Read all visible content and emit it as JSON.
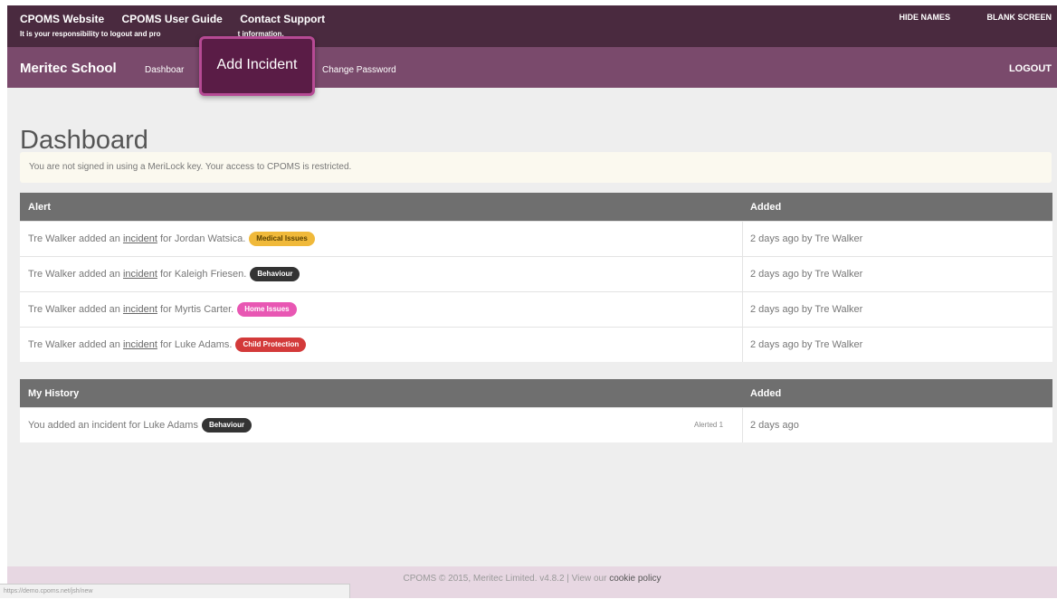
{
  "topbar": {
    "links": [
      "CPOMS Website",
      "CPOMS User Guide",
      "Contact Support"
    ],
    "disclaimer": "It is your responsibility to logout and pro",
    "disclaimer_end": "t information.",
    "hide_names": "HIDE NAMES",
    "blank_screen": "BLANK SCREEN"
  },
  "navbar": {
    "brand": "Meritec School",
    "dashboard": "Dashboar",
    "add_incident": "Add Incident",
    "change_password": "Change Password",
    "logout": "LOGOUT"
  },
  "page": {
    "title": "Dashboard",
    "notice": "You are not signed in using a MeriLock key. Your access to CPOMS is restricted."
  },
  "alerts": {
    "col_alert": "Alert",
    "col_added": "Added",
    "rows": [
      {
        "prefix": "Tre Walker added an ",
        "link": "incident",
        "suffix": " for Jordan Watsica.",
        "badge": "Medical Issues",
        "added": "2 days ago by Tre Walker"
      },
      {
        "prefix": "Tre Walker added an ",
        "link": "incident",
        "suffix": " for Kaleigh Friesen.",
        "badge": "Behaviour",
        "added": "2 days ago by Tre Walker"
      },
      {
        "prefix": "Tre Walker added an ",
        "link": "incident",
        "suffix": " for Myrtis Carter.",
        "badge": "Home Issues",
        "added": "2 days ago by Tre Walker"
      },
      {
        "prefix": "Tre Walker added an ",
        "link": "incident",
        "suffix": " for Luke Adams.",
        "badge": "Child Protection",
        "added": "2 days ago by Tre Walker"
      }
    ]
  },
  "history": {
    "col_history": "My History",
    "col_added": "Added",
    "rows": [
      {
        "text": "You added an incident for Luke Adams",
        "badge": "Behaviour",
        "alerted": "Alerted 1",
        "added": "2 days ago"
      }
    ]
  },
  "footer": {
    "text": "CPOMS © 2015, Meritec Limited. v4.8.2 | View our ",
    "cookie": "cookie policy",
    "status_url": "https://demo.cpoms.net/jsh/new"
  },
  "colors": {
    "topbar": "#4a2a3f",
    "navbar": "#7a4a6c",
    "highlight": "#5a1c46",
    "badge_medical": "#f0b93a",
    "badge_behaviour": "#333333",
    "badge_home": "#e857b3",
    "badge_child": "#d33a3a"
  }
}
